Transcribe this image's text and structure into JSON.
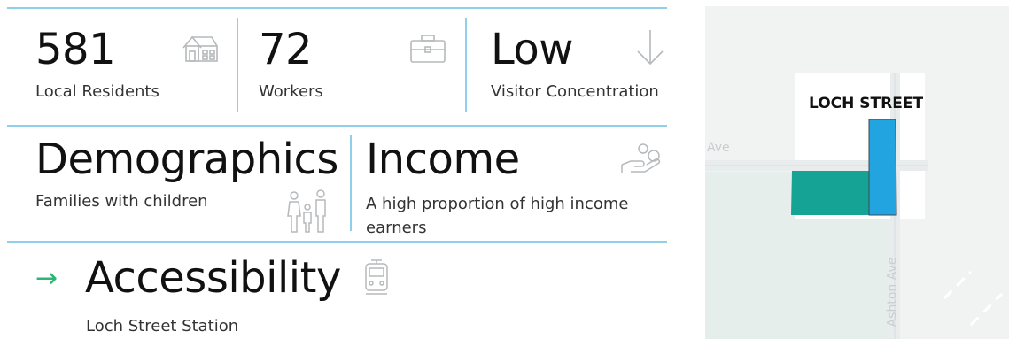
{
  "stats": [
    {
      "value": "581",
      "label": "Local Residents",
      "icon": "house-icon"
    },
    {
      "value": "72",
      "label": "Workers",
      "icon": "briefcase-icon"
    },
    {
      "value": "Low",
      "label": "Visitor Concentration",
      "icon": "arrow-down-icon"
    }
  ],
  "demographics": {
    "title": "Demographics",
    "desc": "Families with children",
    "icon": "family-icon"
  },
  "income": {
    "title": "Income",
    "desc": "A high proportion of high income earners",
    "icon": "hand-coins-icon"
  },
  "accessibility": {
    "arrow": "→",
    "title": "Accessibility",
    "station": "Loch Street Station",
    "icon": "train-icon"
  },
  "map": {
    "site_label": "LOCH STREET",
    "street_west": "Ave",
    "street_south": "Ashton Ave",
    "colors": {
      "teal": "#15a395",
      "blue": "#21a4df",
      "accent_line": "#8fd0e8",
      "arrow": "#2bb673"
    }
  }
}
